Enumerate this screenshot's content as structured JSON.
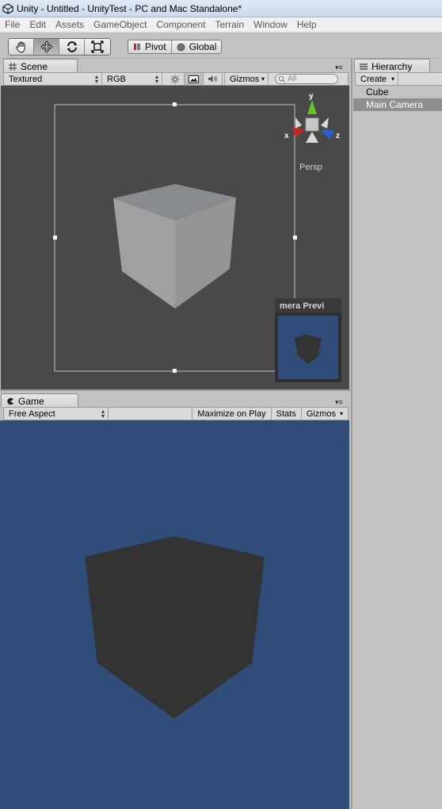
{
  "window": {
    "title": "Unity - Untitled - UnityTest - PC and Mac Standalone*"
  },
  "menu": [
    "File",
    "Edit",
    "Assets",
    "GameObject",
    "Component",
    "Terrain",
    "Window",
    "Help"
  ],
  "toolbar": {
    "tools": [
      {
        "name": "hand-tool",
        "icon": "hand-icon",
        "active": false
      },
      {
        "name": "move-tool",
        "icon": "move-arrows-icon",
        "active": true
      },
      {
        "name": "rotate-tool",
        "icon": "rotate-icon",
        "active": false
      },
      {
        "name": "scale-tool",
        "icon": "scale-icon",
        "active": false
      }
    ],
    "pivot_label": "Pivot",
    "global_label": "Global"
  },
  "scene": {
    "tab_label": "Scene",
    "render_mode": "Textured",
    "channel": "RGB",
    "gizmos_label": "Gizmos",
    "search_placeholder": "All",
    "projection_label": "Persp",
    "axis_x": "x",
    "axis_y": "y",
    "axis_z": "z",
    "camera_preview_title": "mera Previ",
    "colors": {
      "background": "#494949",
      "cube_light": "#9c9c9c",
      "axis_x": "#c0282a",
      "axis_y": "#6bc028",
      "axis_z": "#2a5fd0"
    }
  },
  "game": {
    "tab_label": "Game",
    "aspect": "Free Aspect",
    "maximize_label": "Maximize on Play",
    "stats_label": "Stats",
    "gizmos_label": "Gizmos",
    "colors": {
      "background": "#304d79",
      "cube": "#333333"
    }
  },
  "hierarchy": {
    "tab_label": "Hierarchy",
    "create_label": "Create",
    "items": [
      {
        "label": "Cube",
        "selected": false
      },
      {
        "label": "Main Camera",
        "selected": true
      }
    ]
  }
}
